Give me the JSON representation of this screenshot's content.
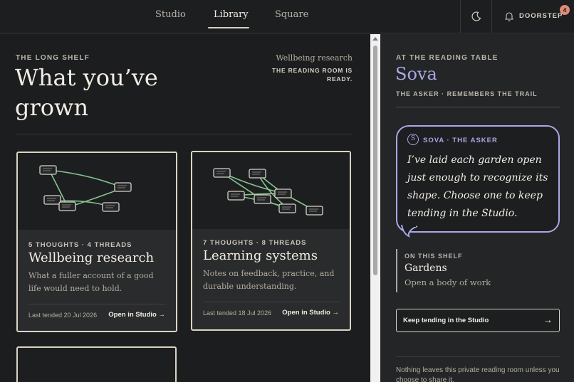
{
  "nav": {
    "tabs": [
      {
        "label": "Studio"
      },
      {
        "label": "Library"
      },
      {
        "label": "Square"
      }
    ],
    "active_tab": "Library",
    "theme_icon": "moon-icon",
    "notifications_icon": "bell-icon",
    "doorstep_label": "DOORSTEP",
    "doorstep_count": "4"
  },
  "library": {
    "eyebrow": "THE LONG SHELF",
    "title": "What you’ve grown",
    "current_garden": "Wellbeing research",
    "status": "THE READING ROOM IS READY.",
    "cards": [
      {
        "stats": "5 THOUGHTS · 4 THREADS",
        "title": "Wellbeing research",
        "description": "What a fuller account of a good life would need to hold.",
        "tended": "Last tended 20 Jul 2026",
        "open_label": "Open in Studio →"
      },
      {
        "stats": "7 THOUGHTS · 8 THREADS",
        "title": "Learning systems",
        "description": "Notes on feedback, practice, and durable understanding.",
        "tended": "Last tended 18 Jul 2026",
        "open_label": "Open in Studio →"
      }
    ]
  },
  "reading_table": {
    "eyebrow": "AT THE READING TABLE",
    "name": "Sova",
    "role": "THE ASKER · REMEMBERS THE TRAIL",
    "avatar_letter": "S",
    "speaker": "SOVA · THE ASKER",
    "message": "I’ve laid each garden open just enough to recognize its shape. Choose one to keep tending in the Studio.",
    "shelf_eyebrow": "ON THIS SHELF",
    "shelf_name": "Gardens",
    "shelf_sub": "Open a body of work",
    "keep_button": "Keep tending in the Studio",
    "keep_arrow": "→",
    "footnote": "Nothing leaves this private reading room unless you choose to share it."
  },
  "colors": {
    "background": "#1c1d1f",
    "accent": "#a9a8e6",
    "thread": "#86c48f",
    "badge": "#e08a7a"
  }
}
